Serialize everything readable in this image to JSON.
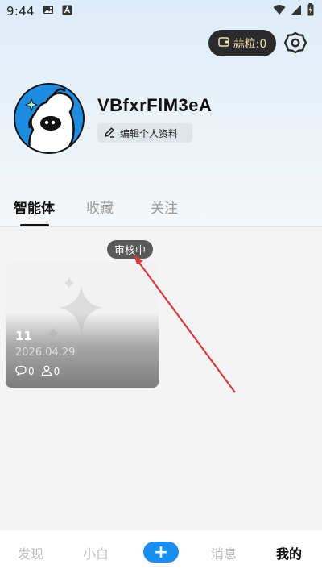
{
  "status_bar": {
    "time": "9:44",
    "icons": [
      "image-icon",
      "a-notification-icon",
      "wifi-icon",
      "signal-icon",
      "battery-charging-icon"
    ]
  },
  "header": {
    "coin_label": "蒜粒:0",
    "coin_icon": "wallet-icon",
    "settings_icon": "gear-icon"
  },
  "profile": {
    "username": "VBfxrFlM3eA",
    "edit_label": "编辑个人资料",
    "edit_icon": "pencil-icon",
    "avatar_bg": "#1c8be0"
  },
  "tabs": [
    {
      "label": "智能体",
      "active": true
    },
    {
      "label": "收藏",
      "active": false
    },
    {
      "label": "关注",
      "active": false
    }
  ],
  "cards": [
    {
      "title": "11",
      "date": "2026.04.29",
      "comments": "0",
      "users": "0",
      "status_badge": "审核中"
    }
  ],
  "bottom_nav": [
    {
      "label": "发现",
      "active": false
    },
    {
      "label": "小白",
      "active": false
    },
    {
      "label": "+",
      "active": false
    },
    {
      "label": "消息",
      "active": false
    },
    {
      "label": "我的",
      "active": true
    }
  ],
  "colors": {
    "accent_blue": "#1a8df0",
    "annotation_red": "#d9393c",
    "coin_pill_bg": "#2b2b2d",
    "coin_text": "#f1e2b0"
  }
}
